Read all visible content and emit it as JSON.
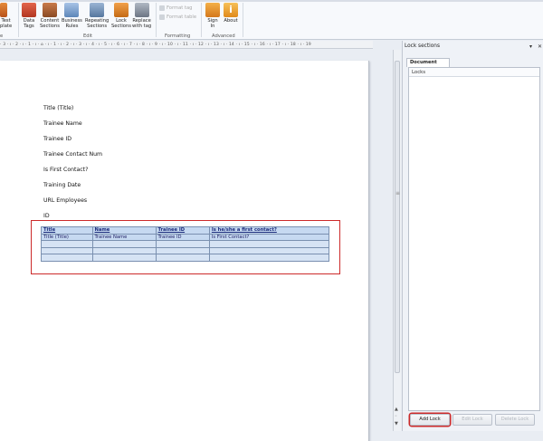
{
  "ribbon": {
    "items": [
      {
        "label": "Test\nplate",
        "icon": "test-template-icon"
      },
      {
        "label": "Data\nTags",
        "icon": "data-tags-icon"
      },
      {
        "label": "Content\nSections",
        "icon": "content-sections-icon"
      },
      {
        "label": "Business\nRules",
        "icon": "business-rules-icon"
      },
      {
        "label": "Repeating\nSections",
        "icon": "repeating-sections-icon"
      },
      {
        "label": "Lock\nSections",
        "icon": "lock-sections-icon"
      },
      {
        "label": "Replace\nwith tag",
        "icon": "replace-with-tag-icon"
      },
      {
        "label": "Sign\nIn",
        "icon": "sign-in-icon"
      },
      {
        "label": "About",
        "icon": "about-icon"
      }
    ],
    "format_tag": "Format tag",
    "format_table": "Format table",
    "groups": {
      "e": "e",
      "edit": "Edit",
      "formatting": "Formatting",
      "advanced": "Advanced"
    }
  },
  "ruler_text": "· 3 · ı · 2 · ı · 1 · ı · ⌂ · ı · 1 · ı · 2 · ı · 3 · ı · 4 · ı · 5 · ı · 6 · ı · 7 · ı · 8 · ı · 9 · ı · 10 · ı · 11 · ı · 12 · ı · 13 · ı · 14 · ı · 15 · ı · 16 · ı · 17 · ı · 18 · ı · 19",
  "document": {
    "fields": [
      "Title (Title)",
      "Trainee Name",
      "Trainee ID",
      "Trainee Contact Num",
      "Is First Contact?",
      "Training Date",
      "URL Employees",
      "ID"
    ],
    "table": {
      "headers": [
        "Title",
        "Name",
        "Trainee ID",
        "Is he/she a first contact?"
      ],
      "row": [
        "Title (Title)",
        "Trainee Name",
        "Trainee ID",
        "Is First Contact?"
      ]
    }
  },
  "panel": {
    "title": "Lock sections",
    "tab": "Document Locks",
    "list_header": "Locks",
    "buttons": {
      "add": "Add Lock",
      "edit": "Edit Lock",
      "delete": "Delete Lock"
    }
  }
}
